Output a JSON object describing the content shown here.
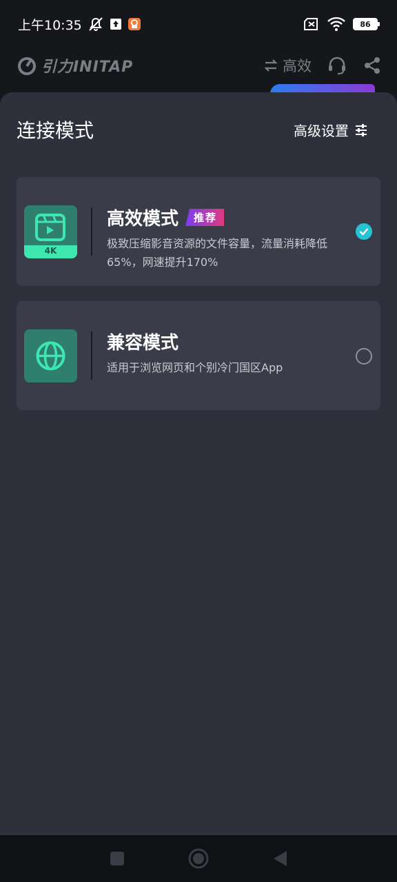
{
  "status_bar": {
    "time": "上午10:35",
    "battery": "86",
    "icons": [
      "mute-icon",
      "upload-icon",
      "app-notification-icon",
      "sim-off-icon",
      "wifi-icon",
      "battery-icon"
    ]
  },
  "app_header": {
    "logo": "引力INITAP",
    "mode_label": "高效",
    "icons": [
      "swap-icon",
      "headset-icon",
      "share-icon"
    ]
  },
  "sheet": {
    "title": "连接模式",
    "advanced_settings": "高级设置",
    "options": [
      {
        "title": "高效模式",
        "badge": "推荐",
        "description": "极致压缩影音资源的文件容量，流量消耗降低65%，网速提升170%",
        "icon": "video-4k-icon",
        "icon_label": "4K",
        "selected": true
      },
      {
        "title": "兼容模式",
        "description": "适用于浏览网页和个别冷门国区App",
        "icon": "globe-icon",
        "selected": false
      }
    ]
  },
  "nav_bar": {
    "icons": [
      "recent-apps-icon",
      "home-icon",
      "back-icon"
    ]
  },
  "colors": {
    "sheet_bg": "#2e313c",
    "card_bg": "#3a3d49",
    "accent_teal": "#25c3d3",
    "icon_bg": "#2f7e6e",
    "icon_green": "#3ee6b0"
  }
}
